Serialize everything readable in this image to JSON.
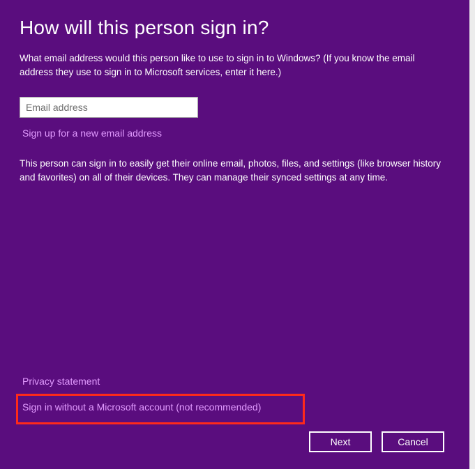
{
  "title": "How will this person sign in?",
  "intro": "What email address would this person like to use to sign in to Windows? (If you know the email address they use to sign in to Microsoft services, enter it here.)",
  "email": {
    "value": "",
    "placeholder": "Email address"
  },
  "links": {
    "signup": "Sign up for a new email address",
    "privacy": "Privacy statement",
    "signin_without": "Sign in without a Microsoft account (not recommended)"
  },
  "description": "This person can sign in to easily get their online email, photos, files, and settings (like browser history and favorites) on all of their devices. They can manage their synced settings at any time.",
  "buttons": {
    "next": "Next",
    "cancel": "Cancel"
  }
}
